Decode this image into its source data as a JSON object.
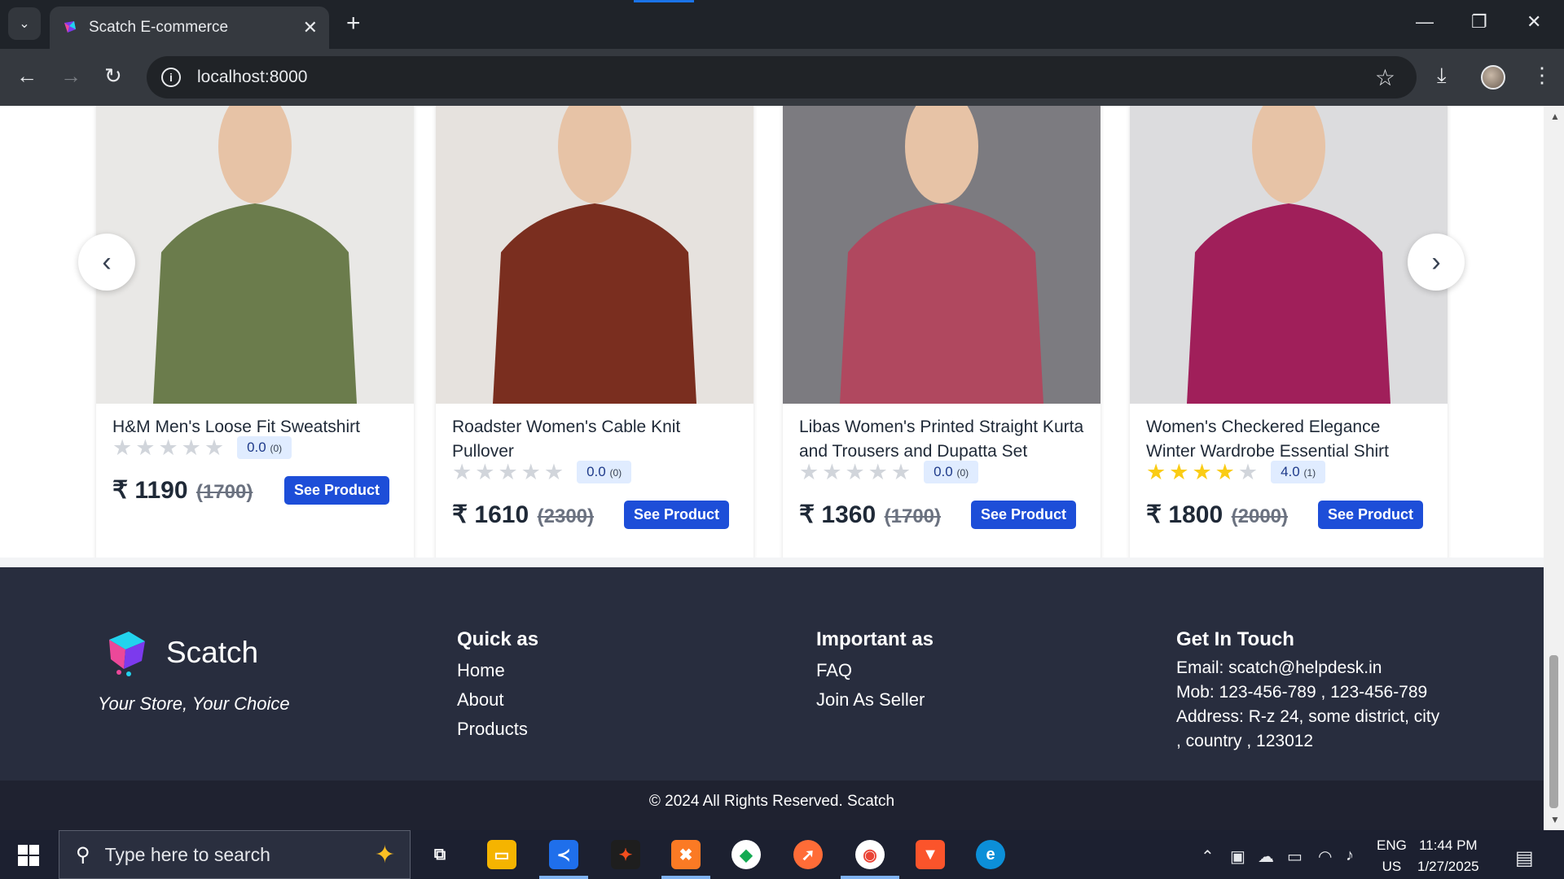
{
  "browser": {
    "tab_title": "Scatch E-commerce",
    "url": "localhost:8000"
  },
  "icons": {
    "tab_search": "chevron-down-icon",
    "close": "close-icon",
    "new_tab": "plus-icon",
    "back": "back-arrow-icon",
    "forward": "forward-arrow-icon",
    "reload": "reload-icon",
    "bookmark": "star-icon",
    "download": "download-icon",
    "menu": "kebab-menu-icon"
  },
  "products": [
    {
      "name": "H&M Men's Loose Fit Sweatshirt",
      "rating": "0.0",
      "rating_count": "(0)",
      "stars": 0,
      "price": "₹ 1190",
      "old_price": "(1700)",
      "button": "See Product",
      "bg": "#e9e8e6",
      "garment": "#6b7c4c"
    },
    {
      "name": "Roadster Women's Cable Knit Pullover",
      "rating": "0.0",
      "rating_count": "(0)",
      "stars": 0,
      "price": "₹ 1610",
      "old_price": "(2300)",
      "button": "See Product",
      "bg": "#e6e2de",
      "garment": "#7a2e1f"
    },
    {
      "name": "Libas Women's Printed Straight Kurta and Trousers and Dupatta Set",
      "rating": "0.0",
      "rating_count": "(0)",
      "stars": 0,
      "price": "₹ 1360",
      "old_price": "(1700)",
      "button": "See Product",
      "bg": "#7c7b80",
      "garment": "#b0485f"
    },
    {
      "name": "Women's Checkered Elegance Winter Wardrobe Essential Shirt",
      "rating": "4.0",
      "rating_count": "(1)",
      "stars": 4,
      "price": "₹ 1800",
      "old_price": "(2000)",
      "button": "See Product",
      "bg": "#dcdcde",
      "garment": "#a01f5a"
    }
  ],
  "carousel": {
    "prev": "‹",
    "next": "›"
  },
  "footer": {
    "brand": "Scatch",
    "tagline": "Your Store, Your Choice",
    "quick_title": "Quick as",
    "quick_links": [
      "Home",
      "About",
      "Products"
    ],
    "important_title": "Important as",
    "important_links": [
      "FAQ",
      "Join As Seller"
    ],
    "contact_title": "Get In Touch",
    "email": "Email: scatch@helpdesk.in",
    "mobile": "Mob: 123-456-789 , 123-456-789",
    "address": "Address: R-z 24, some district, city , country , 123012",
    "copyright": "© 2024 All Rights Reserved. Scatch"
  },
  "taskbar": {
    "search_placeholder": "Type here to search",
    "lang_1": "ENG",
    "lang_2": "US",
    "time": "11:44 PM",
    "date": "1/27/2025"
  },
  "colors": {
    "accent": "#1d4ed8",
    "footer_bg": "#282d3e",
    "star_on": "#facc15"
  }
}
